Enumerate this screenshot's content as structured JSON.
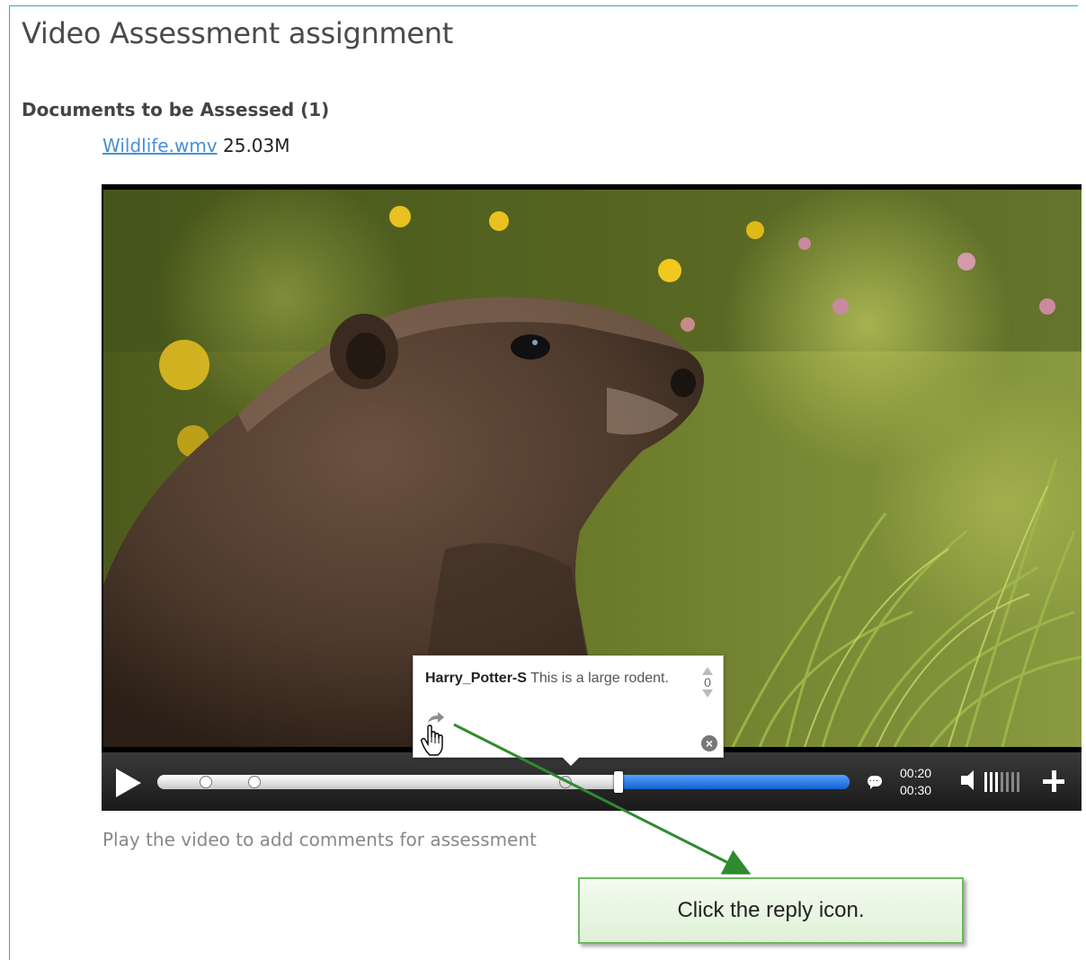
{
  "page": {
    "title": "Video Assessment assignment",
    "section_heading": "Documents to be Assessed (1)",
    "document": {
      "name": "Wildlife.wmv",
      "size": "25.03M"
    },
    "hint": "Play the video to add comments for assessment"
  },
  "player": {
    "time_current": "00:20",
    "time_total": "00:30",
    "progress_fraction": 0.6667,
    "volume_level_bars": 3,
    "volume_total_bars": 7,
    "comment_markers_fraction": [
      0.07,
      0.14,
      0.59
    ],
    "icons": {
      "play": "play-icon",
      "comment": "speech-bubble-icon",
      "volume": "speaker-icon",
      "fullscreen": "plus-icon"
    }
  },
  "comment_popup": {
    "username": "Harry_Potter-S",
    "text": "This is a large rodent.",
    "vote_count": "0",
    "icons": {
      "reply": "reply-arrow-icon",
      "close": "close-circle-icon",
      "vote_up": "up-arrow-icon",
      "vote_down": "down-arrow-icon"
    }
  },
  "callout": {
    "text": "Click the reply icon.",
    "color_border": "#6db95f",
    "arrow_color": "#2e8b2e"
  }
}
